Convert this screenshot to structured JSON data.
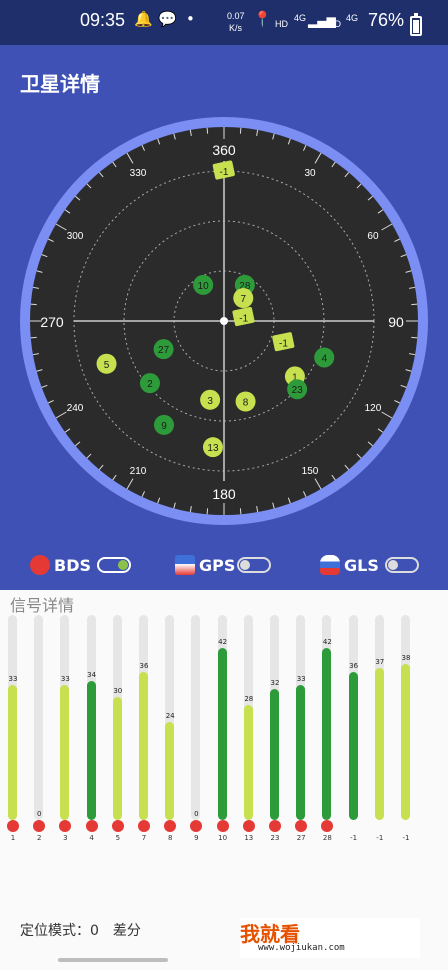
{
  "status_bar": {
    "time": "09:35",
    "net_speed_top": "0.07",
    "net_speed_unit": "K/s",
    "hd1": "HD",
    "net1": "4G",
    "hd2": "HD",
    "net2": "4G",
    "battery": "76%"
  },
  "page_title": "卫星详情",
  "sky_plot": {
    "compass_labels": [
      "360",
      "30",
      "60",
      "90",
      "120",
      "150",
      "180",
      "210",
      "240",
      "270",
      "300",
      "330"
    ],
    "satellites": [
      {
        "id": "-1",
        "az": 0,
        "elev": 0,
        "color": "#c6e04f",
        "marker": "flag"
      },
      {
        "id": "10",
        "az": 330,
        "elev": 65,
        "color": "#2e9b3a",
        "marker": "circle"
      },
      {
        "id": "28",
        "az": 30,
        "elev": 65,
        "color": "#2e9b3a",
        "marker": "circle"
      },
      {
        "id": "7",
        "az": 40,
        "elev": 72,
        "color": "#c6e04f",
        "marker": "circle"
      },
      {
        "id": "-1",
        "az": 80,
        "elev": 78,
        "color": "#c6e04f",
        "marker": "flag"
      },
      {
        "id": "-1",
        "az": 110,
        "elev": 52,
        "color": "#c6e04f",
        "marker": "flag"
      },
      {
        "id": "4",
        "az": 110,
        "elev": 26,
        "color": "#2e9b3a",
        "marker": "circle"
      },
      {
        "id": "1",
        "az": 128,
        "elev": 36,
        "color": "#c6e04f",
        "marker": "circle"
      },
      {
        "id": "23",
        "az": 133,
        "elev": 30,
        "color": "#2e9b3a",
        "marker": "circle"
      },
      {
        "id": "8",
        "az": 165,
        "elev": 40,
        "color": "#c6e04f",
        "marker": "circle"
      },
      {
        "id": "3",
        "az": 190,
        "elev": 42,
        "color": "#c6e04f",
        "marker": "circle"
      },
      {
        "id": "13",
        "az": 185,
        "elev": 14,
        "color": "#c6e04f",
        "marker": "circle"
      },
      {
        "id": "9",
        "az": 210,
        "elev": 18,
        "color": "#2e9b3a",
        "marker": "circle"
      },
      {
        "id": "2",
        "az": 230,
        "elev": 32,
        "color": "#2e9b3a",
        "marker": "circle"
      },
      {
        "id": "27",
        "az": 245,
        "elev": 50,
        "color": "#2e9b3a",
        "marker": "circle"
      },
      {
        "id": "5",
        "az": 250,
        "elev": 15,
        "color": "#c6e04f",
        "marker": "circle"
      }
    ]
  },
  "legend": [
    {
      "label": "BDS",
      "on": true,
      "flag_color": "#e53935"
    },
    {
      "label": "GPS",
      "on": false,
      "flag_color": "#3f6fd8"
    },
    {
      "label": "GLS",
      "on": false,
      "flag_color": "#e0e0e0"
    }
  ],
  "signal_panel": {
    "title": "信号详情",
    "bars": [
      {
        "label": "1",
        "value": 33,
        "color": "#c6e04f"
      },
      {
        "label": "2",
        "value": 0,
        "color": "#c6e04f"
      },
      {
        "label": "3",
        "value": 33,
        "color": "#c6e04f"
      },
      {
        "label": "4",
        "value": 34,
        "color": "#2e9b3a"
      },
      {
        "label": "5",
        "value": 30,
        "color": "#c6e04f"
      },
      {
        "label": "7",
        "value": 36,
        "color": "#c6e04f"
      },
      {
        "label": "8",
        "value": 24,
        "color": "#c6e04f"
      },
      {
        "label": "9",
        "value": 0,
        "color": "#2e9b3a"
      },
      {
        "label": "10",
        "value": 42,
        "color": "#2e9b3a"
      },
      {
        "label": "13",
        "value": 28,
        "color": "#c6e04f"
      },
      {
        "label": "23",
        "value": 32,
        "color": "#2e9b3a"
      },
      {
        "label": "27",
        "value": 33,
        "color": "#2e9b3a"
      },
      {
        "label": "28",
        "value": 42,
        "color": "#2e9b3a"
      },
      {
        "label": "-1",
        "value": 36,
        "color": "#2e9b3a"
      },
      {
        "label": "-1",
        "value": 37,
        "color": "#c6e04f"
      },
      {
        "label": "-1",
        "value": 38,
        "color": "#c6e04f"
      }
    ],
    "max_value": 50
  },
  "footer": {
    "mode_text": "定位模式：0　差分"
  },
  "watermark": {
    "main": "我就看",
    "url": "www.wojiukan.com"
  }
}
